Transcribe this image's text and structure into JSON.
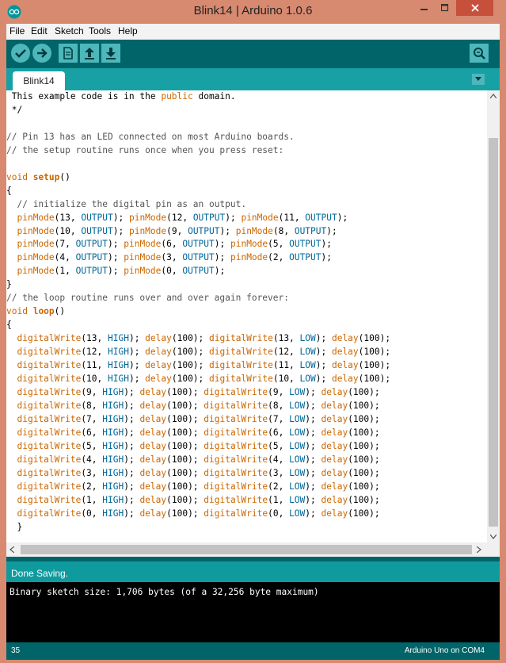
{
  "window": {
    "title": "Blink14 | Arduino 1.0.6",
    "menu": [
      "File",
      "Edit",
      "Sketch",
      "Tools",
      "Help"
    ]
  },
  "toolbar": {
    "buttons": [
      "verify-icon",
      "upload-icon",
      "new-icon",
      "open-icon",
      "save-icon",
      "serial-monitor-icon"
    ]
  },
  "tabs": [
    {
      "label": "Blink14"
    }
  ],
  "editor": {
    "lines": [
      [
        [
          "t",
          " This example code is in the "
        ],
        [
          "k",
          "public"
        ],
        [
          "t",
          " domain."
        ]
      ],
      [
        [
          "t",
          " */"
        ]
      ],
      [
        [
          "t",
          ""
        ]
      ],
      [
        [
          "c",
          "// Pin 13 has an LED connected on most Arduino boards."
        ]
      ],
      [
        [
          "c",
          "// the setup routine runs once when you press reset:"
        ]
      ],
      [
        [
          "t",
          ""
        ]
      ],
      [
        [
          "k",
          "void"
        ],
        [
          "t",
          " "
        ],
        [
          "b",
          "setup"
        ],
        [
          "t",
          "()"
        ]
      ],
      [
        [
          "t",
          "{"
        ]
      ],
      [
        [
          "t",
          "  "
        ],
        [
          "c",
          "// initialize the digital pin as an output."
        ]
      ],
      [
        [
          "t",
          "  "
        ],
        [
          "k",
          "pinMode"
        ],
        [
          "t",
          "(13, "
        ],
        [
          "n",
          "OUTPUT"
        ],
        [
          "t",
          "); "
        ],
        [
          "k",
          "pinMode"
        ],
        [
          "t",
          "(12, "
        ],
        [
          "n",
          "OUTPUT"
        ],
        [
          "t",
          "); "
        ],
        [
          "k",
          "pinMode"
        ],
        [
          "t",
          "(11, "
        ],
        [
          "n",
          "OUTPUT"
        ],
        [
          "t",
          ");"
        ]
      ],
      [
        [
          "t",
          "  "
        ],
        [
          "k",
          "pinMode"
        ],
        [
          "t",
          "(10, "
        ],
        [
          "n",
          "OUTPUT"
        ],
        [
          "t",
          "); "
        ],
        [
          "k",
          "pinMode"
        ],
        [
          "t",
          "(9, "
        ],
        [
          "n",
          "OUTPUT"
        ],
        [
          "t",
          "); "
        ],
        [
          "k",
          "pinMode"
        ],
        [
          "t",
          "(8, "
        ],
        [
          "n",
          "OUTPUT"
        ],
        [
          "t",
          ");"
        ]
      ],
      [
        [
          "t",
          "  "
        ],
        [
          "k",
          "pinMode"
        ],
        [
          "t",
          "(7, "
        ],
        [
          "n",
          "OUTPUT"
        ],
        [
          "t",
          "); "
        ],
        [
          "k",
          "pinMode"
        ],
        [
          "t",
          "(6, "
        ],
        [
          "n",
          "OUTPUT"
        ],
        [
          "t",
          "); "
        ],
        [
          "k",
          "pinMode"
        ],
        [
          "t",
          "(5, "
        ],
        [
          "n",
          "OUTPUT"
        ],
        [
          "t",
          ");"
        ]
      ],
      [
        [
          "t",
          "  "
        ],
        [
          "k",
          "pinMode"
        ],
        [
          "t",
          "(4, "
        ],
        [
          "n",
          "OUTPUT"
        ],
        [
          "t",
          "); "
        ],
        [
          "k",
          "pinMode"
        ],
        [
          "t",
          "(3, "
        ],
        [
          "n",
          "OUTPUT"
        ],
        [
          "t",
          "); "
        ],
        [
          "k",
          "pinMode"
        ],
        [
          "t",
          "(2, "
        ],
        [
          "n",
          "OUTPUT"
        ],
        [
          "t",
          ");"
        ]
      ],
      [
        [
          "t",
          "  "
        ],
        [
          "k",
          "pinMode"
        ],
        [
          "t",
          "(1, "
        ],
        [
          "n",
          "OUTPUT"
        ],
        [
          "t",
          "); "
        ],
        [
          "k",
          "pinMode"
        ],
        [
          "t",
          "(0, "
        ],
        [
          "n",
          "OUTPUT"
        ],
        [
          "t",
          ");"
        ]
      ],
      [
        [
          "t",
          "}"
        ]
      ],
      [
        [
          "c",
          "// the loop routine runs over and over again forever:"
        ]
      ],
      [
        [
          "k",
          "void"
        ],
        [
          "t",
          " "
        ],
        [
          "b",
          "loop"
        ],
        [
          "t",
          "()"
        ]
      ],
      [
        [
          "t",
          "{"
        ]
      ],
      [
        [
          "t",
          "  "
        ],
        [
          "k",
          "digitalWrite"
        ],
        [
          "t",
          "(13, "
        ],
        [
          "n",
          "HIGH"
        ],
        [
          "t",
          "); "
        ],
        [
          "k",
          "delay"
        ],
        [
          "t",
          "(100); "
        ],
        [
          "k",
          "digitalWrite"
        ],
        [
          "t",
          "(13, "
        ],
        [
          "n",
          "LOW"
        ],
        [
          "t",
          "); "
        ],
        [
          "k",
          "delay"
        ],
        [
          "t",
          "(100);"
        ]
      ],
      [
        [
          "t",
          "  "
        ],
        [
          "k",
          "digitalWrite"
        ],
        [
          "t",
          "(12, "
        ],
        [
          "n",
          "HIGH"
        ],
        [
          "t",
          "); "
        ],
        [
          "k",
          "delay"
        ],
        [
          "t",
          "(100); "
        ],
        [
          "k",
          "digitalWrite"
        ],
        [
          "t",
          "(12, "
        ],
        [
          "n",
          "LOW"
        ],
        [
          "t",
          "); "
        ],
        [
          "k",
          "delay"
        ],
        [
          "t",
          "(100);"
        ]
      ],
      [
        [
          "t",
          "  "
        ],
        [
          "k",
          "digitalWrite"
        ],
        [
          "t",
          "(11, "
        ],
        [
          "n",
          "HIGH"
        ],
        [
          "t",
          "); "
        ],
        [
          "k",
          "delay"
        ],
        [
          "t",
          "(100); "
        ],
        [
          "k",
          "digitalWrite"
        ],
        [
          "t",
          "(11, "
        ],
        [
          "n",
          "LOW"
        ],
        [
          "t",
          "); "
        ],
        [
          "k",
          "delay"
        ],
        [
          "t",
          "(100);"
        ]
      ],
      [
        [
          "t",
          "  "
        ],
        [
          "k",
          "digitalWrite"
        ],
        [
          "t",
          "(10, "
        ],
        [
          "n",
          "HIGH"
        ],
        [
          "t",
          "); "
        ],
        [
          "k",
          "delay"
        ],
        [
          "t",
          "(100); "
        ],
        [
          "k",
          "digitalWrite"
        ],
        [
          "t",
          "(10, "
        ],
        [
          "n",
          "LOW"
        ],
        [
          "t",
          "); "
        ],
        [
          "k",
          "delay"
        ],
        [
          "t",
          "(100);"
        ]
      ],
      [
        [
          "t",
          "  "
        ],
        [
          "k",
          "digitalWrite"
        ],
        [
          "t",
          "(9, "
        ],
        [
          "n",
          "HIGH"
        ],
        [
          "t",
          "); "
        ],
        [
          "k",
          "delay"
        ],
        [
          "t",
          "(100); "
        ],
        [
          "k",
          "digitalWrite"
        ],
        [
          "t",
          "(9, "
        ],
        [
          "n",
          "LOW"
        ],
        [
          "t",
          "); "
        ],
        [
          "k",
          "delay"
        ],
        [
          "t",
          "(100);"
        ]
      ],
      [
        [
          "t",
          "  "
        ],
        [
          "k",
          "digitalWrite"
        ],
        [
          "t",
          "(8, "
        ],
        [
          "n",
          "HIGH"
        ],
        [
          "t",
          "); "
        ],
        [
          "k",
          "delay"
        ],
        [
          "t",
          "(100); "
        ],
        [
          "k",
          "digitalWrite"
        ],
        [
          "t",
          "(8, "
        ],
        [
          "n",
          "LOW"
        ],
        [
          "t",
          "); "
        ],
        [
          "k",
          "delay"
        ],
        [
          "t",
          "(100);"
        ]
      ],
      [
        [
          "t",
          "  "
        ],
        [
          "k",
          "digitalWrite"
        ],
        [
          "t",
          "(7, "
        ],
        [
          "n",
          "HIGH"
        ],
        [
          "t",
          "); "
        ],
        [
          "k",
          "delay"
        ],
        [
          "t",
          "(100); "
        ],
        [
          "k",
          "digitalWrite"
        ],
        [
          "t",
          "(7, "
        ],
        [
          "n",
          "LOW"
        ],
        [
          "t",
          "); "
        ],
        [
          "k",
          "delay"
        ],
        [
          "t",
          "(100);"
        ]
      ],
      [
        [
          "t",
          "  "
        ],
        [
          "k",
          "digitalWrite"
        ],
        [
          "t",
          "(6, "
        ],
        [
          "n",
          "HIGH"
        ],
        [
          "t",
          "); "
        ],
        [
          "k",
          "delay"
        ],
        [
          "t",
          "(100); "
        ],
        [
          "k",
          "digitalWrite"
        ],
        [
          "t",
          "(6, "
        ],
        [
          "n",
          "LOW"
        ],
        [
          "t",
          "); "
        ],
        [
          "k",
          "delay"
        ],
        [
          "t",
          "(100);"
        ]
      ],
      [
        [
          "t",
          "  "
        ],
        [
          "k",
          "digitalWrite"
        ],
        [
          "t",
          "(5, "
        ],
        [
          "n",
          "HIGH"
        ],
        [
          "t",
          "); "
        ],
        [
          "k",
          "delay"
        ],
        [
          "t",
          "(100); "
        ],
        [
          "k",
          "digitalWrite"
        ],
        [
          "t",
          "(5, "
        ],
        [
          "n",
          "LOW"
        ],
        [
          "t",
          "); "
        ],
        [
          "k",
          "delay"
        ],
        [
          "t",
          "(100);"
        ]
      ],
      [
        [
          "t",
          "  "
        ],
        [
          "k",
          "digitalWrite"
        ],
        [
          "t",
          "(4, "
        ],
        [
          "n",
          "HIGH"
        ],
        [
          "t",
          "); "
        ],
        [
          "k",
          "delay"
        ],
        [
          "t",
          "(100); "
        ],
        [
          "k",
          "digitalWrite"
        ],
        [
          "t",
          "(4, "
        ],
        [
          "n",
          "LOW"
        ],
        [
          "t",
          "); "
        ],
        [
          "k",
          "delay"
        ],
        [
          "t",
          "(100);"
        ]
      ],
      [
        [
          "t",
          "  "
        ],
        [
          "k",
          "digitalWrite"
        ],
        [
          "t",
          "(3, "
        ],
        [
          "n",
          "HIGH"
        ],
        [
          "t",
          "); "
        ],
        [
          "k",
          "delay"
        ],
        [
          "t",
          "(100); "
        ],
        [
          "k",
          "digitalWrite"
        ],
        [
          "t",
          "(3, "
        ],
        [
          "n",
          "LOW"
        ],
        [
          "t",
          "); "
        ],
        [
          "k",
          "delay"
        ],
        [
          "t",
          "(100);"
        ]
      ],
      [
        [
          "t",
          "  "
        ],
        [
          "k",
          "digitalWrite"
        ],
        [
          "t",
          "(2, "
        ],
        [
          "n",
          "HIGH"
        ],
        [
          "t",
          "); "
        ],
        [
          "k",
          "delay"
        ],
        [
          "t",
          "(100); "
        ],
        [
          "k",
          "digitalWrite"
        ],
        [
          "t",
          "(2, "
        ],
        [
          "n",
          "LOW"
        ],
        [
          "t",
          "); "
        ],
        [
          "k",
          "delay"
        ],
        [
          "t",
          "(100);"
        ]
      ],
      [
        [
          "t",
          "  "
        ],
        [
          "k",
          "digitalWrite"
        ],
        [
          "t",
          "(1, "
        ],
        [
          "n",
          "HIGH"
        ],
        [
          "t",
          "); "
        ],
        [
          "k",
          "delay"
        ],
        [
          "t",
          "(100); "
        ],
        [
          "k",
          "digitalWrite"
        ],
        [
          "t",
          "(1, "
        ],
        [
          "n",
          "LOW"
        ],
        [
          "t",
          "); "
        ],
        [
          "k",
          "delay"
        ],
        [
          "t",
          "(100);"
        ]
      ],
      [
        [
          "t",
          "  "
        ],
        [
          "k",
          "digitalWrite"
        ],
        [
          "t",
          "(0, "
        ],
        [
          "n",
          "HIGH"
        ],
        [
          "t",
          "); "
        ],
        [
          "k",
          "delay"
        ],
        [
          "t",
          "(100); "
        ],
        [
          "k",
          "digitalWrite"
        ],
        [
          "t",
          "(0, "
        ],
        [
          "n",
          "LOW"
        ],
        [
          "t",
          "); "
        ],
        [
          "k",
          "delay"
        ],
        [
          "t",
          "(100);"
        ]
      ],
      [
        [
          "t",
          "  }"
        ]
      ]
    ]
  },
  "status": {
    "message": "Done Saving."
  },
  "console": {
    "output": "Binary sketch size: 1,706 bytes (of a 32,256 byte maximum)"
  },
  "footer": {
    "line": "35",
    "board": "Arduino Uno on COM4"
  },
  "colors": {
    "toolbar": "#006468",
    "tabbar": "#17a1a5",
    "keyword": "#cc6600",
    "constant": "#006699",
    "comment": "#555555"
  }
}
